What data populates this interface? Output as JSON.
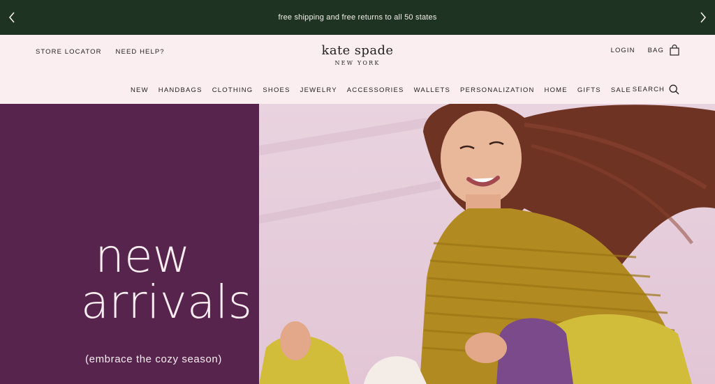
{
  "promo": {
    "text": "free shipping and free returns to all 50 states",
    "prev_icon": "chevron-left-icon",
    "next_icon": "chevron-right-icon"
  },
  "header": {
    "utility_left": [
      "STORE LOCATOR",
      "NEED HELP?"
    ],
    "logo": {
      "main": "kate spade",
      "sub": "NEW YORK"
    },
    "login": "LOGIN",
    "bag": "BAG",
    "search": "SEARCH",
    "nav": [
      "NEW",
      "HANDBAGS",
      "CLOTHING",
      "SHOES",
      "JEWELRY",
      "ACCESSORIES",
      "WALLETS",
      "PERSONALIZATION",
      "HOME",
      "GIFTS",
      "SALE"
    ]
  },
  "hero": {
    "line1": "new",
    "line2": "arrivals",
    "tagline": "(embrace the cozy season)"
  },
  "colors": {
    "promo_bg": "#1f3323",
    "header_bg": "#fbeef1",
    "hero_left_bg": "#57244e",
    "sweater": "#b28a22",
    "hair": "#6f3323",
    "bag_purple": "#7a4a8a",
    "bag_yellow": "#d2bd3a"
  }
}
